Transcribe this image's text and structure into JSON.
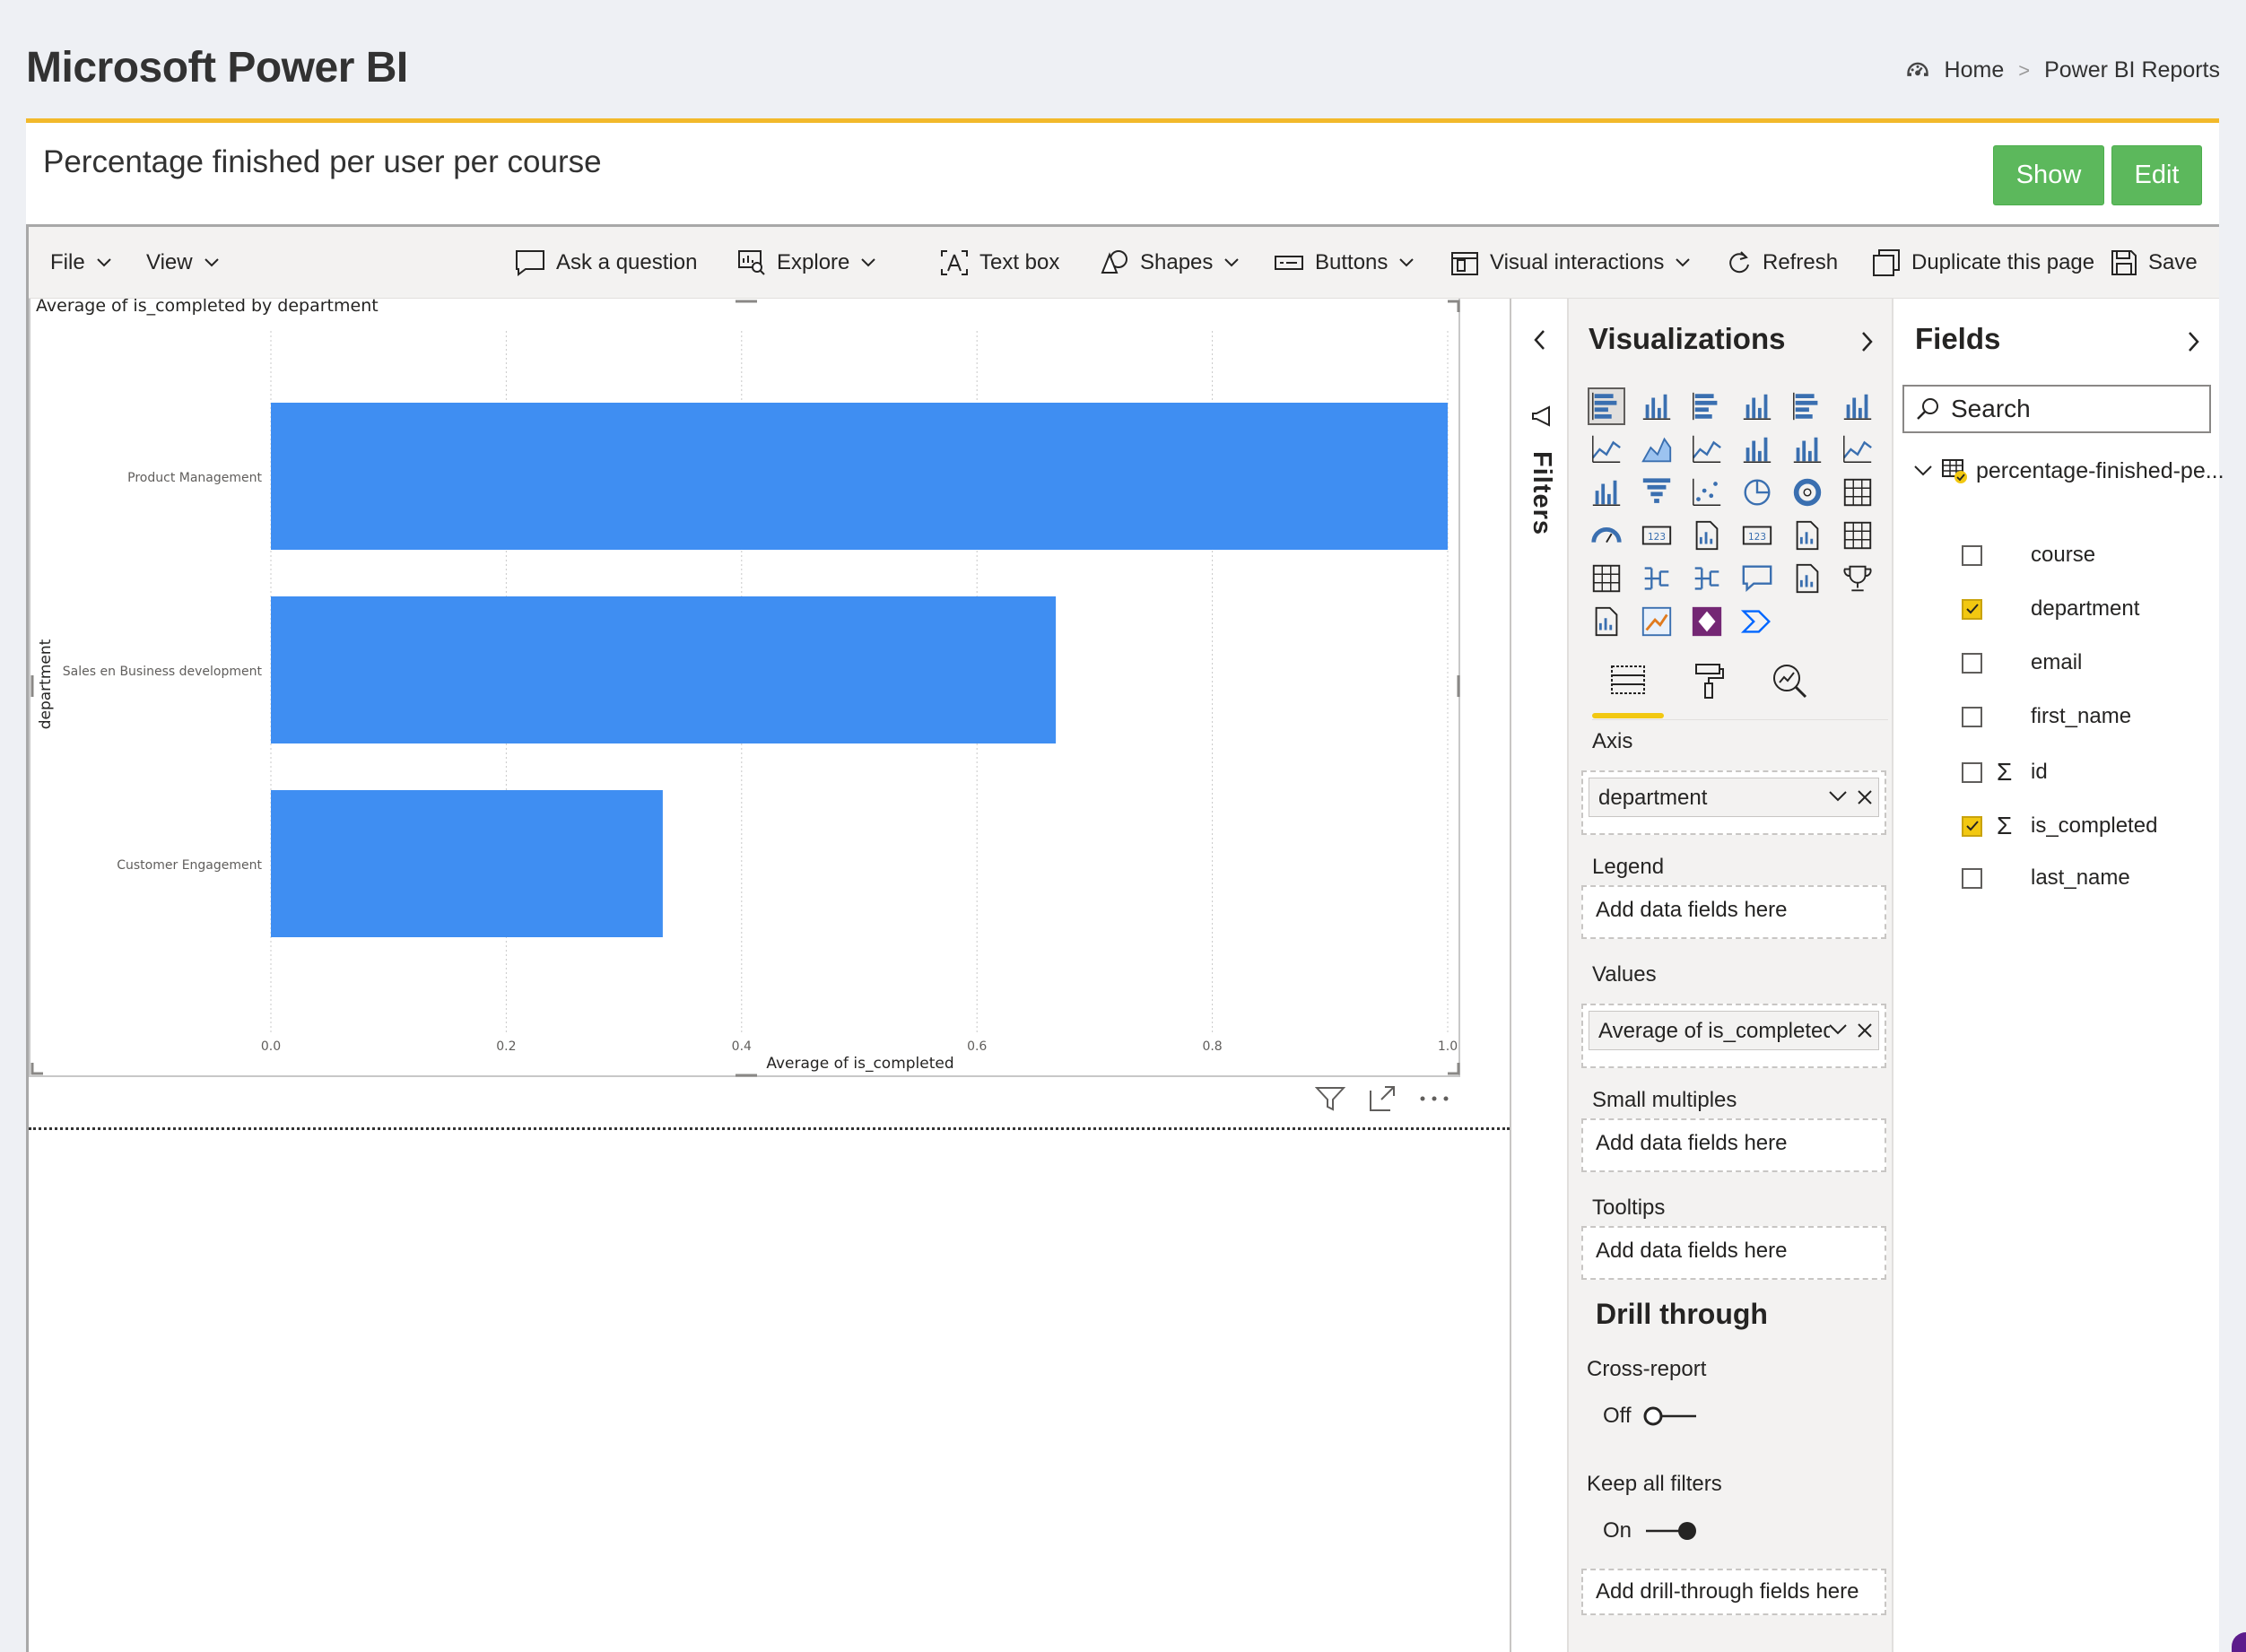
{
  "app": {
    "title": "Microsoft Power BI"
  },
  "breadcrumb": {
    "home": "Home",
    "separator": ">",
    "current": "Power BI Reports"
  },
  "report": {
    "title": "Percentage finished per user per course",
    "show_label": "Show",
    "edit_label": "Edit"
  },
  "toolbar": {
    "file": "File",
    "view": "View",
    "ask_question": "Ask a question",
    "explore": "Explore",
    "text_box": "Text box",
    "shapes": "Shapes",
    "buttons": "Buttons",
    "visual_interactions": "Visual interactions",
    "refresh": "Refresh",
    "duplicate_page": "Duplicate this page",
    "save": "Save"
  },
  "chart_data": {
    "type": "bar",
    "orientation": "horizontal",
    "title": "Average of is_completed by department",
    "xlabel": "Average of is_completed",
    "ylabel": "department",
    "categories": [
      "Product Management",
      "Sales en Business development",
      "Customer Engagement"
    ],
    "values": [
      1.0,
      0.667,
      0.333
    ],
    "xlim": [
      0,
      1.0
    ],
    "xticks": [
      "0.0",
      "0.2",
      "0.4",
      "0.6",
      "0.8",
      "1.0"
    ],
    "grid": "vertical dotted",
    "bar_color": "#3f8ef2"
  },
  "filters": {
    "label": "Filters"
  },
  "visualizations": {
    "title": "Visualizations",
    "icons": [
      "stacked-bar-icon",
      "stacked-column-icon",
      "clustered-bar-icon",
      "clustered-column-icon",
      "100-stacked-bar-icon",
      "100-stacked-column-icon",
      "line-chart-icon",
      "area-chart-icon",
      "stacked-area-icon",
      "line-column-icon",
      "line-clustered-column-icon",
      "ribbon-chart-icon",
      "waterfall-icon",
      "funnel-icon",
      "scatter-icon",
      "pie-icon",
      "donut-icon",
      "treemap-icon",
      "gauge-icon",
      "card-icon",
      "multi-row-card-icon",
      "kpi-icon",
      "slicer-icon",
      "table-icon",
      "matrix-icon",
      "decomposition-tree-icon",
      "key-influencers-icon",
      "qa-icon",
      "smart-narrative-icon",
      "trophy-icon",
      "paginated-report-icon",
      "arcgis-map-icon",
      "power-apps-icon",
      "power-automate-icon"
    ],
    "wells": {
      "axis": {
        "label": "Axis",
        "value": "department"
      },
      "legend": {
        "label": "Legend",
        "placeholder": "Add data fields here"
      },
      "values": {
        "label": "Values",
        "value": "Average of is_completed"
      },
      "small_multiples": {
        "label": "Small multiples",
        "placeholder": "Add data fields here"
      },
      "tooltips": {
        "label": "Tooltips",
        "placeholder": "Add data fields here"
      }
    },
    "drill_through": {
      "title": "Drill through",
      "cross_report": {
        "label": "Cross-report",
        "state": "Off"
      },
      "keep_filters": {
        "label": "Keep all filters",
        "state": "On"
      },
      "placeholder": "Add drill-through fields here"
    }
  },
  "fields": {
    "title": "Fields",
    "search_placeholder": "Search",
    "table_name": "percentage-finished-pe...",
    "items": [
      {
        "name": "course",
        "checked": false,
        "sigma": false
      },
      {
        "name": "department",
        "checked": true,
        "sigma": false
      },
      {
        "name": "email",
        "checked": false,
        "sigma": false
      },
      {
        "name": "first_name",
        "checked": false,
        "sigma": false
      },
      {
        "name": "id",
        "checked": false,
        "sigma": true
      },
      {
        "name": "is_completed",
        "checked": true,
        "sigma": true
      },
      {
        "name": "last_name",
        "checked": false,
        "sigma": false
      }
    ]
  },
  "colors": {
    "accent": "#f2b92b",
    "green": "#5cb85c",
    "bar": "#3f8ef2",
    "check": "#f2c811"
  }
}
